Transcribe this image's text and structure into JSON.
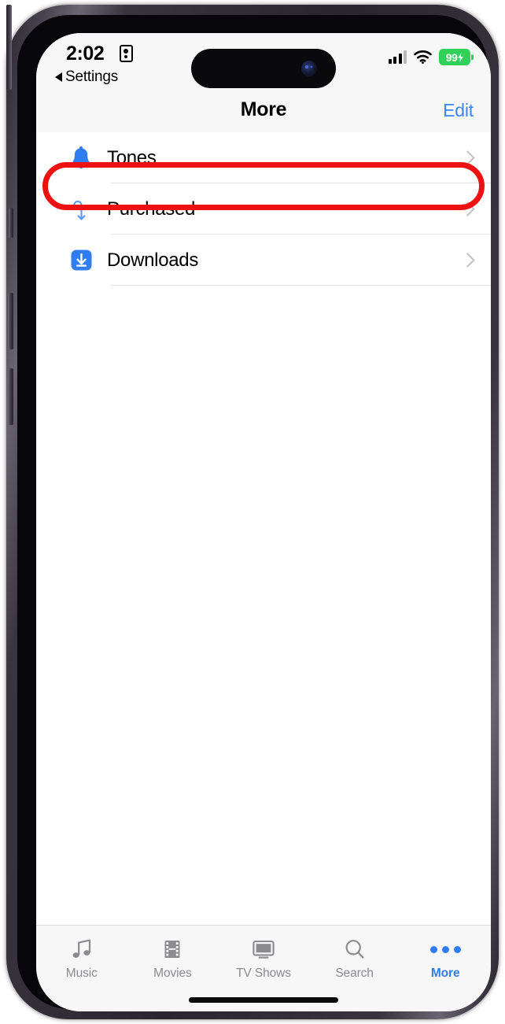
{
  "status_bar": {
    "time": "2:02",
    "lock_icon": "portrait-orientation-lock-icon",
    "back_link": "Settings",
    "back_icon": "back-triangle-icon",
    "cellular_icon": "cellular-signal-icon",
    "wifi_icon": "wifi-icon",
    "battery_level": "99",
    "battery_icon": "battery-charging-icon",
    "battery_color": "#30d158"
  },
  "nav_bar": {
    "title": "More",
    "edit_label": "Edit",
    "edit_color": "#3b86f0"
  },
  "list": {
    "rows": [
      {
        "label": "Tones",
        "icon": "bell-icon",
        "chevron": "chevron-right-icon"
      },
      {
        "label": "Purchased",
        "icon": "purchased-tag-icon",
        "chevron": "chevron-right-icon"
      },
      {
        "label": "Downloads",
        "icon": "download-square-icon",
        "chevron": "chevron-right-icon"
      }
    ]
  },
  "annotation": {
    "target": "Tones",
    "color": "#ee1111",
    "shape": "rounded-rectangle-outline"
  },
  "tab_bar": {
    "tabs": [
      {
        "label": "Music",
        "icon": "music-note-icon",
        "active": false
      },
      {
        "label": "Movies",
        "icon": "film-strip-icon",
        "active": false
      },
      {
        "label": "TV Shows",
        "icon": "tv-icon",
        "active": false
      },
      {
        "label": "Search",
        "icon": "search-icon",
        "active": false
      },
      {
        "label": "More",
        "icon": "ellipsis-icon",
        "active": true
      }
    ],
    "active_color": "#2f7df0",
    "inactive_color": "#8b8b90"
  }
}
